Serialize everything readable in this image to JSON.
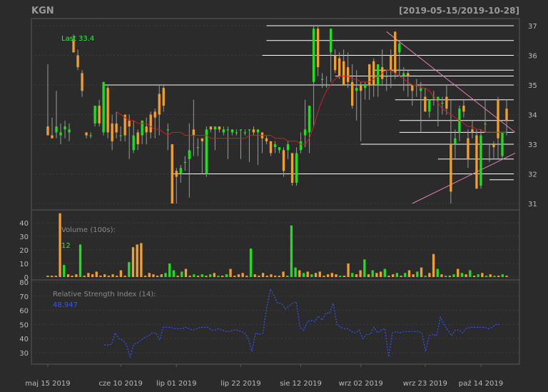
{
  "header": {
    "symbol": "KGN",
    "range": "[2019-05-15/2019-10-28]"
  },
  "colors": {
    "bg": "#2b2b2b",
    "panel_border": "#5a5a5a",
    "grid": "#3c3c3c",
    "up": "#22dd22",
    "down": "#f0a030",
    "ma": "#cc2222",
    "rsi": "#3355ff",
    "hline": "#ffffff",
    "trend": "#e080b0",
    "text": "#bbbbbb"
  },
  "chart_data": [
    {
      "type": "candlestick",
      "title": "KGN",
      "last_label": "Last 33.4",
      "ylim": [
        30.8,
        37.2
      ],
      "yticks": [
        31,
        32,
        33,
        34,
        35,
        36,
        37
      ],
      "xticks": [
        "maj 15 2019",
        "cze 10 2019",
        "lip 01 2019",
        "lip 22 2019",
        "sie 12 2019",
        "wrz 02 2019",
        "wrz 23 2019",
        "paź 14 2019"
      ],
      "xtick_index": [
        0,
        17,
        30,
        45,
        59,
        73,
        88,
        101
      ],
      "candles": [
        {
          "o": 33.6,
          "h": 35.7,
          "l": 33.5,
          "c": 33.3
        },
        {
          "o": 33.3,
          "h": 33.9,
          "l": 33.2,
          "c": 33.2
        },
        {
          "o": 33.4,
          "h": 34.8,
          "l": 33.2,
          "c": 33.6
        },
        {
          "o": 33.3,
          "h": 33.7,
          "l": 33.0,
          "c": 33.4
        },
        {
          "o": 33.5,
          "h": 33.8,
          "l": 33.2,
          "c": 33.6
        },
        {
          "o": 33.4,
          "h": 33.7,
          "l": 33.1,
          "c": 33.5
        },
        {
          "o": 36.5,
          "h": 36.7,
          "l": 36.1,
          "c": 36.1
        },
        {
          "o": 36.0,
          "h": 36.2,
          "l": 35.5,
          "c": 35.6
        },
        {
          "o": 35.4,
          "h": 35.5,
          "l": 34.6,
          "c": 34.8
        },
        {
          "o": 33.4,
          "h": 33.4,
          "l": 33.2,
          "c": 33.3
        },
        {
          "o": 33.3,
          "h": 33.4,
          "l": 33.2,
          "c": 33.3
        },
        {
          "o": 33.7,
          "h": 34.3,
          "l": 33.6,
          "c": 34.3
        },
        {
          "o": 34.3,
          "h": 34.5,
          "l": 33.6,
          "c": 33.7
        },
        {
          "o": 33.4,
          "h": 35.1,
          "l": 33.3,
          "c": 35.1
        },
        {
          "o": 34.9,
          "h": 35.0,
          "l": 33.2,
          "c": 33.4
        },
        {
          "o": 33.7,
          "h": 34.0,
          "l": 32.8,
          "c": 33.1
        },
        {
          "o": 33.7,
          "h": 34.1,
          "l": 33.2,
          "c": 33.4
        },
        {
          "o": 33.3,
          "h": 33.6,
          "l": 33.1,
          "c": 33.3
        },
        {
          "o": 34.0,
          "h": 34.0,
          "l": 33.1,
          "c": 33.3
        },
        {
          "o": 33.8,
          "h": 34.0,
          "l": 32.5,
          "c": 33.6
        },
        {
          "o": 32.8,
          "h": 33.8,
          "l": 32.7,
          "c": 33.3
        },
        {
          "o": 33.4,
          "h": 33.5,
          "l": 32.8,
          "c": 33.0
        },
        {
          "o": 33.3,
          "h": 33.8,
          "l": 33.0,
          "c": 33.8
        },
        {
          "o": 33.6,
          "h": 33.9,
          "l": 33.0,
          "c": 33.4
        },
        {
          "o": 34.0,
          "h": 34.1,
          "l": 33.2,
          "c": 33.4
        },
        {
          "o": 34.1,
          "h": 34.2,
          "l": 33.2,
          "c": 33.9
        },
        {
          "o": 34.7,
          "h": 35.0,
          "l": 33.3,
          "c": 34.0
        },
        {
          "o": 34.9,
          "h": 35.0,
          "l": 34.1,
          "c": 34.3
        },
        {
          "o": 33.5,
          "h": 33.7,
          "l": 32.8,
          "c": 33.5
        },
        {
          "o": 33.0,
          "h": 33.0,
          "l": 31.0,
          "c": 31.0
        },
        {
          "o": 32.1,
          "h": 32.2,
          "l": 31.0,
          "c": 31.9
        },
        {
          "o": 32.0,
          "h": 32.3,
          "l": 31.7,
          "c": 32.2
        },
        {
          "o": 32.4,
          "h": 32.6,
          "l": 32.1,
          "c": 32.4
        },
        {
          "o": 32.5,
          "h": 33.7,
          "l": 31.2,
          "c": 32.8
        },
        {
          "o": 33.5,
          "h": 34.5,
          "l": 32.6,
          "c": 33.3
        },
        {
          "o": 32.9,
          "h": 33.2,
          "l": 32.6,
          "c": 32.9
        },
        {
          "o": 33.2,
          "h": 33.2,
          "l": 32.0,
          "c": 33.1
        },
        {
          "o": 32.0,
          "h": 33.6,
          "l": 31.9,
          "c": 33.5
        },
        {
          "o": 33.6,
          "h": 33.6,
          "l": 33.4,
          "c": 33.5
        },
        {
          "o": 33.5,
          "h": 33.6,
          "l": 32.8,
          "c": 33.6
        },
        {
          "o": 33.6,
          "h": 33.6,
          "l": 33.4,
          "c": 33.5
        },
        {
          "o": 33.4,
          "h": 33.6,
          "l": 33.3,
          "c": 33.5
        },
        {
          "o": 33.5,
          "h": 33.6,
          "l": 32.5,
          "c": 33.5
        },
        {
          "o": 33.4,
          "h": 33.5,
          "l": 33.3,
          "c": 33.5
        },
        {
          "o": 33.4,
          "h": 33.5,
          "l": 33.3,
          "c": 33.4
        },
        {
          "o": 33.5,
          "h": 33.5,
          "l": 32.5,
          "c": 33.5
        },
        {
          "o": 33.4,
          "h": 33.5,
          "l": 33.3,
          "c": 33.4
        },
        {
          "o": 33.5,
          "h": 33.5,
          "l": 32.4,
          "c": 33.5
        },
        {
          "o": 33.5,
          "h": 33.6,
          "l": 33.3,
          "c": 33.4
        },
        {
          "o": 33.4,
          "h": 33.5,
          "l": 32.3,
          "c": 33.5
        },
        {
          "o": 33.4,
          "h": 33.4,
          "l": 32.7,
          "c": 33.2
        },
        {
          "o": 33.2,
          "h": 33.3,
          "l": 33.0,
          "c": 33.1
        },
        {
          "o": 33.1,
          "h": 33.1,
          "l": 32.6,
          "c": 32.7
        },
        {
          "o": 32.9,
          "h": 33.1,
          "l": 32.7,
          "c": 33.0
        },
        {
          "o": 32.8,
          "h": 32.9,
          "l": 32.7,
          "c": 32.9
        },
        {
          "o": 32.8,
          "h": 32.9,
          "l": 31.9,
          "c": 32.1
        },
        {
          "o": 32.8,
          "h": 33.1,
          "l": 32.5,
          "c": 33.0
        },
        {
          "o": 32.7,
          "h": 32.7,
          "l": 31.6,
          "c": 31.7
        },
        {
          "o": 31.7,
          "h": 32.9,
          "l": 31.6,
          "c": 32.7
        },
        {
          "o": 32.8,
          "h": 33.4,
          "l": 32.7,
          "c": 33.1
        },
        {
          "o": 33.3,
          "h": 34.5,
          "l": 32.9,
          "c": 33.5
        },
        {
          "o": 33.4,
          "h": 34.3,
          "l": 32.7,
          "c": 34.3
        },
        {
          "o": 35.1,
          "h": 37.0,
          "l": 33.6,
          "c": 36.9
        },
        {
          "o": 36.9,
          "h": 37.0,
          "l": 35.3,
          "c": 35.6
        },
        {
          "o": 35.2,
          "h": 35.4,
          "l": 34.9,
          "c": 35.2
        },
        {
          "o": 35.0,
          "h": 35.3,
          "l": 34.9,
          "c": 35.0
        },
        {
          "o": 36.1,
          "h": 36.9,
          "l": 35.1,
          "c": 36.9
        },
        {
          "o": 36.0,
          "h": 36.2,
          "l": 35.4,
          "c": 35.5
        },
        {
          "o": 35.9,
          "h": 36.1,
          "l": 35.2,
          "c": 35.3
        },
        {
          "o": 35.8,
          "h": 36.2,
          "l": 35.0,
          "c": 35.0
        },
        {
          "o": 35.6,
          "h": 36.1,
          "l": 34.9,
          "c": 35.1
        },
        {
          "o": 35.1,
          "h": 35.7,
          "l": 34.2,
          "c": 34.3
        },
        {
          "o": 34.8,
          "h": 35.5,
          "l": 33.8,
          "c": 34.9
        },
        {
          "o": 35.0,
          "h": 35.1,
          "l": 33.1,
          "c": 34.8
        },
        {
          "o": 34.9,
          "h": 35.1,
          "l": 34.5,
          "c": 35.0
        },
        {
          "o": 35.7,
          "h": 35.7,
          "l": 34.5,
          "c": 35.0
        },
        {
          "o": 35.8,
          "h": 35.9,
          "l": 34.6,
          "c": 35.0
        },
        {
          "o": 35.0,
          "h": 35.7,
          "l": 34.6,
          "c": 35.7
        },
        {
          "o": 35.6,
          "h": 36.2,
          "l": 35.0,
          "c": 35.2
        },
        {
          "o": 35.3,
          "h": 35.5,
          "l": 34.8,
          "c": 35.3
        },
        {
          "o": 36.0,
          "h": 36.2,
          "l": 34.9,
          "c": 35.5
        },
        {
          "o": 36.8,
          "h": 36.8,
          "l": 35.2,
          "c": 35.4
        },
        {
          "o": 36.1,
          "h": 36.5,
          "l": 35.3,
          "c": 36.4
        },
        {
          "o": 35.3,
          "h": 35.6,
          "l": 34.8,
          "c": 35.4
        },
        {
          "o": 35.4,
          "h": 35.5,
          "l": 34.6,
          "c": 35.3
        },
        {
          "o": 35.0,
          "h": 35.0,
          "l": 34.3,
          "c": 34.8
        },
        {
          "o": 35.0,
          "h": 35.2,
          "l": 34.6,
          "c": 35.0
        },
        {
          "o": 34.8,
          "h": 35.1,
          "l": 33.4,
          "c": 34.9
        },
        {
          "o": 34.6,
          "h": 34.9,
          "l": 34.1,
          "c": 34.1
        },
        {
          "o": 34.1,
          "h": 34.5,
          "l": 33.9,
          "c": 34.5
        },
        {
          "o": 34.6,
          "h": 34.8,
          "l": 34.3,
          "c": 34.6
        },
        {
          "o": 34.5,
          "h": 34.6,
          "l": 33.6,
          "c": 34.6
        },
        {
          "o": 34.4,
          "h": 34.6,
          "l": 34.0,
          "c": 34.4
        },
        {
          "o": 34.6,
          "h": 35.0,
          "l": 34.0,
          "c": 34.2
        },
        {
          "o": 33.0,
          "h": 34.5,
          "l": 31.0,
          "c": 31.4
        },
        {
          "o": 33.0,
          "h": 33.5,
          "l": 32.5,
          "c": 33.2
        },
        {
          "o": 33.4,
          "h": 34.3,
          "l": 33.1,
          "c": 34.2
        },
        {
          "o": 34.3,
          "h": 34.5,
          "l": 33.9,
          "c": 34.1
        },
        {
          "o": 33.2,
          "h": 33.5,
          "l": 32.2,
          "c": 32.5
        },
        {
          "o": 33.5,
          "h": 33.8,
          "l": 33.2,
          "c": 33.4
        },
        {
          "o": 33.3,
          "h": 33.5,
          "l": 31.5,
          "c": 31.5
        },
        {
          "o": 31.6,
          "h": 33.5,
          "l": 31.5,
          "c": 33.3
        },
        {
          "o": 33.7,
          "h": 34.5,
          "l": 33.4,
          "c": 33.7
        },
        {
          "o": 32.5,
          "h": 33.0,
          "l": 32.4,
          "c": 32.5
        },
        {
          "o": 33.0,
          "h": 33.1,
          "l": 32.5,
          "c": 32.9
        },
        {
          "o": 34.5,
          "h": 34.6,
          "l": 32.5,
          "c": 33.2
        },
        {
          "o": 32.6,
          "h": 33.4,
          "l": 32.5,
          "c": 33.4
        },
        {
          "o": 34.2,
          "h": 34.5,
          "l": 33.3,
          "c": 33.8
        }
      ],
      "ma": [
        34.1,
        34.0,
        33.9,
        33.8,
        33.8,
        33.7,
        33.7,
        33.7,
        33.6,
        33.5,
        33.5,
        33.4,
        33.3,
        33.4,
        33.4,
        33.4,
        33.3,
        33.3,
        33.3,
        33.3,
        33.3,
        33.3,
        33.2,
        33.2,
        33.2,
        33.2,
        33.2,
        33.2,
        33.2,
        33.2,
        33.2,
        33.3,
        33.3,
        33.3,
        33.3,
        33.3,
        33.3,
        33.2,
        33.2,
        33.2,
        33.1,
        33.1,
        33.1,
        33.0,
        33.0,
        33.2,
        33.6,
        34.1,
        34.5,
        34.8,
        35.0,
        35.2,
        35.3,
        35.3,
        35.3,
        35.2,
        35.2,
        35.1,
        35.1,
        35.1,
        35.2,
        35.3,
        35.4,
        35.5,
        35.5,
        35.4,
        35.3,
        35.2,
        35.1,
        35.0,
        35.0,
        34.9,
        34.9,
        34.8,
        34.6,
        34.4,
        34.2,
        34.1,
        34.0,
        33.9,
        33.8,
        33.7,
        33.6,
        33.6,
        33.5,
        33.5,
        33.4,
        33.4,
        33.4,
        33.4,
        33.4,
        33.4,
        33.4,
        33.4,
        33.4,
        33.4,
        33.4,
        33.4,
        33.4,
        33.4,
        33.4,
        33.3,
        33.3,
        33.3,
        33.3,
        33.3
      ],
      "ma_start_index": 16,
      "horizontal_levels": [
        {
          "y": 37.0,
          "from": 52
        },
        {
          "y": 36.5,
          "from": 52
        },
        {
          "y": 36.0,
          "from": 51
        },
        {
          "y": 35.5,
          "from": 77
        },
        {
          "y": 35.3,
          "from": 68
        },
        {
          "y": 35.0,
          "from": 14
        },
        {
          "y": 34.5,
          "from": 82
        },
        {
          "y": 33.8,
          "from": 83
        },
        {
          "y": 33.4,
          "from": 83
        },
        {
          "y": 33.0,
          "from": 74
        },
        {
          "y": 32.5,
          "from": 92
        },
        {
          "y": 32.0,
          "from": 30
        },
        {
          "y": 31.8,
          "from": 104
        }
      ],
      "trendlines": [
        {
          "x1": 79,
          "y1": 36.8,
          "x2": 112,
          "y2": 33.4
        },
        {
          "x1": 85,
          "y1": 31.0,
          "x2": 113,
          "y2": 32.7
        }
      ]
    },
    {
      "type": "bar",
      "title": "Volume (100s):",
      "last_value_label": "12",
      "ylim": [
        0,
        48
      ],
      "yticks": [
        0,
        10,
        20,
        30,
        40
      ],
      "values": [
        1,
        1,
        1,
        47,
        9,
        2,
        1,
        2,
        24,
        1,
        3,
        2,
        4,
        1,
        2,
        1,
        2,
        1,
        5,
        1,
        11,
        22,
        24,
        25,
        1,
        3,
        2,
        1,
        2,
        3,
        10,
        5,
        1,
        4,
        6,
        1,
        2,
        1,
        2,
        1,
        2,
        3,
        1,
        1,
        2,
        6,
        1,
        2,
        3,
        1,
        21,
        2,
        1,
        3,
        1,
        2,
        1,
        1,
        4,
        1,
        38,
        7,
        5,
        3,
        4,
        2,
        3,
        4,
        1,
        2,
        3,
        2,
        1,
        1,
        10,
        3,
        2,
        5,
        13,
        2,
        5,
        3,
        4,
        6,
        1,
        2,
        3,
        1,
        3,
        5,
        2,
        4,
        7,
        1,
        3,
        17,
        6,
        2,
        1,
        1,
        2,
        6,
        3,
        2,
        5,
        1,
        2,
        3,
        1,
        2,
        1,
        1,
        2,
        1
      ],
      "colors_up": [
        4,
        8,
        20,
        29,
        30,
        31,
        33,
        36,
        38,
        40,
        42,
        44,
        50,
        59,
        60,
        61,
        63,
        65,
        72,
        75,
        78,
        80,
        83,
        86,
        88,
        91,
        93,
        96,
        98,
        100,
        102,
        104,
        106,
        108,
        110,
        112
      ]
    },
    {
      "type": "line",
      "title": "Relative Strength Index (14):",
      "last_value_label": "48.947",
      "ylim": [
        26,
        80
      ],
      "yticks": [
        30,
        40,
        50,
        60,
        70,
        80
      ],
      "start_index": 16,
      "values": [
        35.5,
        35.5,
        36,
        44,
        40,
        39,
        36,
        27,
        36,
        37,
        39,
        41,
        42,
        44,
        44,
        39,
        48,
        48,
        48,
        47,
        47,
        47,
        48,
        47,
        46,
        47,
        48,
        48,
        48,
        46,
        46,
        47,
        46,
        45,
        45,
        46,
        46,
        45,
        44,
        40,
        31,
        44,
        43,
        44,
        62,
        75,
        70,
        65,
        65,
        61,
        63,
        65,
        66,
        48,
        46,
        52,
        53,
        52,
        56,
        53,
        58,
        58,
        65,
        50,
        48,
        47,
        47,
        45,
        44,
        46,
        40,
        43,
        43,
        48,
        44,
        46,
        47,
        27,
        44,
        45,
        44,
        45,
        45,
        45,
        45,
        45,
        44,
        31,
        42,
        43,
        42,
        55,
        50,
        46,
        42,
        46,
        46,
        44,
        47,
        48,
        48,
        48,
        48,
        48,
        47,
        48,
        50,
        50
      ]
    }
  ]
}
